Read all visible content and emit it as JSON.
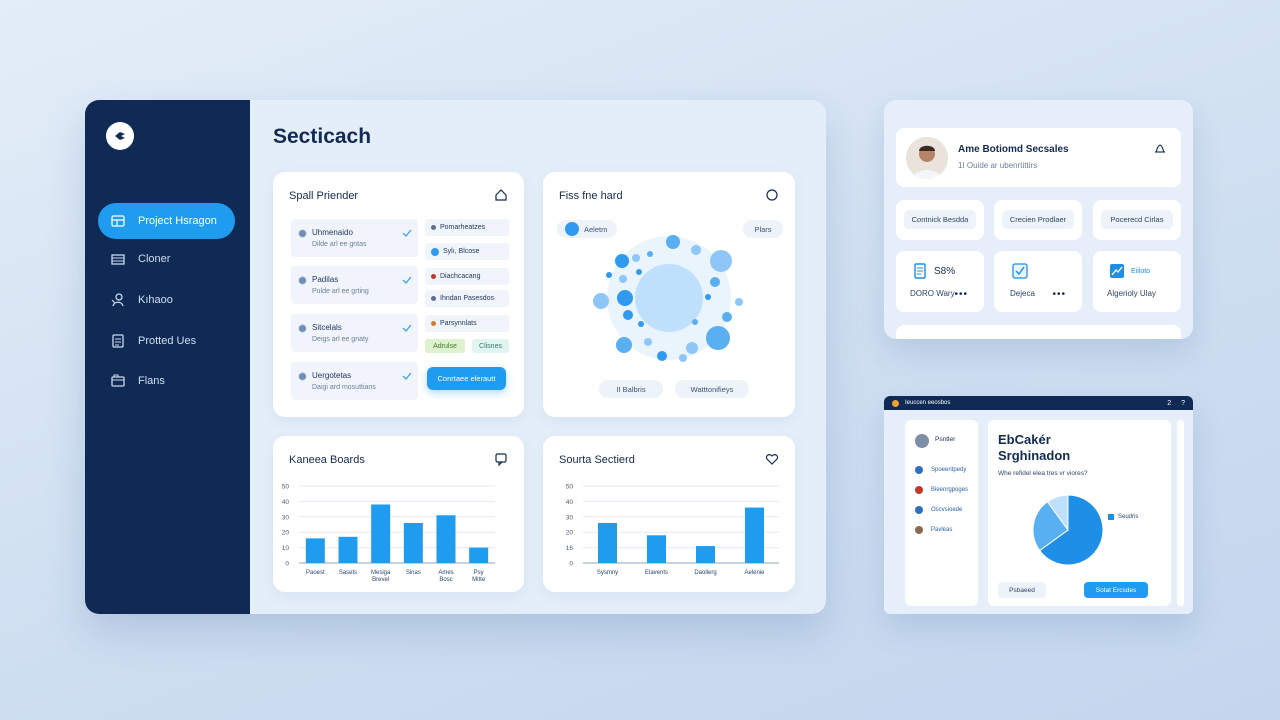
{
  "main": {
    "title": "Secticach",
    "sidebar": {
      "items": [
        {
          "label": "Project Hsragon",
          "icon": "layers-icon",
          "active": true
        },
        {
          "label": "Cloner",
          "icon": "stack-icon"
        },
        {
          "label": "Kıhaoo",
          "icon": "user-icon"
        },
        {
          "label": "Protted Ues",
          "icon": "document-icon"
        },
        {
          "label": "Flans",
          "icon": "folder-icon"
        }
      ]
    },
    "spall_card": {
      "title": "Spall Priender",
      "rows": [
        {
          "label": "Uhmenaido",
          "sub": "Dilde arl ee gntas"
        },
        {
          "label": "Padilas",
          "sub": "Pulde arl ee grting"
        },
        {
          "label": "Sitcelals",
          "sub": "Deigs arl ee gnaty"
        },
        {
          "label": "Uergotetas",
          "sub": "Daigi ard mosuttians"
        }
      ],
      "tags": [
        "Pomarheatzes",
        "Sylı, Blcose",
        "Diachcacang",
        "Ihndan Pasesdos",
        "Parsynnlats"
      ],
      "green_tags": [
        "Adrulse",
        "Clisnes"
      ],
      "action": "Conrtaee elerautt"
    },
    "bubble_card": {
      "title": "Fiss fne hard",
      "pill_left": "Aeletm",
      "pill_right": "Plars",
      "footer_left": "II Balbris",
      "footer_right": "Watttonifieys"
    },
    "bar_card_left": {
      "title": "Kaneea Boards"
    },
    "bar_card_right": {
      "title": "Sourta Sectierd"
    }
  },
  "chart_data": [
    {
      "type": "bar",
      "title": "Kaneea Boards",
      "categories": [
        "Paoest",
        "Sasets",
        "Mesiga Brevel",
        "Sinas",
        "Ames Bosc",
        "Psy Mitte"
      ],
      "values": [
        16,
        17,
        38,
        26,
        31,
        10
      ],
      "ytick_labels": [
        "0",
        "10",
        "20",
        "30",
        "40",
        "50"
      ],
      "ylim": [
        0,
        50
      ],
      "grid": true
    },
    {
      "type": "bar",
      "title": "Sourta Sectierd",
      "categories": [
        "Sysmny",
        "Elavents",
        "Daollerg",
        "Aelenie"
      ],
      "values": [
        26,
        18,
        11,
        36
      ],
      "ytick_labels": [
        "0",
        "16",
        "20",
        "30",
        "40",
        "50"
      ],
      "ylim": [
        0,
        50
      ],
      "grid": true
    },
    {
      "type": "pie",
      "slices": [
        {
          "label": "Seudris",
          "value": 65
        },
        {
          "label": "",
          "value": 25
        },
        {
          "label": "",
          "value": 10
        }
      ]
    }
  ],
  "right_panel": {
    "profile_name": "Ame Botiomd Secsales",
    "profile_sub": "1I Ouide ar ubenrtittirs",
    "chips": [
      "Contnick Besdda",
      "Crecien Prodlaer",
      "Pocerecd Cirlas"
    ],
    "stats": [
      {
        "value": "S8%",
        "label": "DORO Wary",
        "icon": "file-icon"
      },
      {
        "value": "",
        "label": "Dejeca",
        "icon": "checkbox-icon"
      },
      {
        "value": "",
        "label": "Algerioly Ulay",
        "icon": "trend-icon",
        "tag": "Eiiloto"
      }
    ]
  },
  "bottom_panel": {
    "topbar": "Ieuccen eeosbos",
    "topbar_right": [
      "2",
      "?"
    ],
    "user": "Psntler",
    "menu": [
      "Spoeentpedy",
      "Bieenrgpoges",
      "Oscvsioede",
      "Pavleas"
    ],
    "title_line1": "EbCakér",
    "title_line2": "Srghinadon",
    "subtitle": "Whe refidel elea tres vr viores?",
    "legend": "Seudris",
    "btn_secondary": "Psbaeed",
    "btn_primary": "Sotat Ercsdes"
  },
  "colors": {
    "accent": "#1f9cf0",
    "sidebar": "#0f2a55",
    "bar": "#1f9cf0",
    "bubble": "#8ec7f7"
  }
}
